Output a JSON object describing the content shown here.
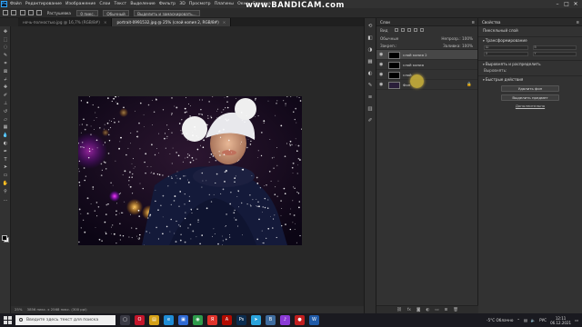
{
  "app": {
    "name": "Adobe Photoshop",
    "logo": "Ps"
  },
  "watermark": "www.BANDICAM.com",
  "menu": [
    "Файл",
    "Редактирование",
    "Изображение",
    "Слои",
    "Текст",
    "Выделение",
    "Фильтр",
    "3D",
    "Просмотр",
    "Плагины",
    "Окно",
    "Справка"
  ],
  "options_bar": {
    "label1": "Растушевка",
    "value1": "0 пикс.",
    "label2": "Обычный",
    "label3": "Выделить и замаскировать..."
  },
  "tabs": [
    {
      "label": "ночь-полностью.jpg @ 16,7% (RGB/8#)",
      "active": false
    },
    {
      "label": "portrait-0991532.jpg @ 25% (слой копия 2, RGB/8#)",
      "active": true
    }
  ],
  "status": {
    "zoom": "25%",
    "doc": "3856 пикс. x 2568 пикс. (300 ppi)"
  },
  "layers_panel": {
    "title": "Слои",
    "filter_label": "Вид",
    "blend_mode": "Обычные",
    "opacity": "Непрозр.: 100%",
    "lock_label": "Закреп.:",
    "fill": "Заливка: 100%",
    "layers": [
      {
        "name": "слой копия 2",
        "thumb": "black",
        "selected": true
      },
      {
        "name": "слой копия",
        "thumb": "black",
        "selected": false
      },
      {
        "name": "слой",
        "thumb": "black",
        "selected": false
      },
      {
        "name": "Фон",
        "thumb": "photo",
        "selected": false,
        "locked": true
      }
    ]
  },
  "properties_panel": {
    "title": "Свойства",
    "subtitle": "Пиксельный слой",
    "section1": "Трансформирование",
    "fields": [
      "Ш",
      "В",
      "X",
      "Y"
    ],
    "section2": "Выровнять и распределить",
    "align_label": "Выровнять:",
    "section3": "Быстрые действия",
    "btn1": "Удалить фон",
    "btn2": "Выделить предмет",
    "more": "Дополнительно"
  },
  "taskbar": {
    "search_placeholder": "Введите здесь текст для поиска",
    "weather": "-5°C Облачно",
    "lang": "РУС",
    "time": "12:11",
    "date": "06.12.2021",
    "apps": [
      {
        "icon": "task-view-icon",
        "color": "#3a3a44",
        "glyph": "▢"
      },
      {
        "icon": "opera-icon",
        "color": "#c4152a",
        "glyph": "O"
      },
      {
        "icon": "explorer-icon",
        "color": "#d4a017",
        "glyph": "▤"
      },
      {
        "icon": "edge-icon",
        "color": "#1f8dd6",
        "glyph": "e"
      },
      {
        "icon": "store-icon",
        "color": "#2f6ad3",
        "glyph": "▣"
      },
      {
        "icon": "chrome-icon",
        "color": "#2e9b4b",
        "glyph": "◉"
      },
      {
        "icon": "yandex-icon",
        "color": "#e0332b",
        "glyph": "Я"
      },
      {
        "icon": "acrobat-icon",
        "color": "#b30b00",
        "glyph": "A"
      },
      {
        "icon": "photoshop-icon",
        "color": "#0b2d50",
        "glyph": "Ps"
      },
      {
        "icon": "telegram-icon",
        "color": "#2aa3dc",
        "glyph": "➤"
      },
      {
        "icon": "vk-icon",
        "color": "#3f6da0",
        "glyph": "B"
      },
      {
        "icon": "music-icon",
        "color": "#8b3ad6",
        "glyph": "♪"
      },
      {
        "icon": "record-icon",
        "color": "#c21e1e",
        "glyph": "●"
      },
      {
        "icon": "word-icon",
        "color": "#1f5aa8",
        "glyph": "W"
      }
    ]
  }
}
